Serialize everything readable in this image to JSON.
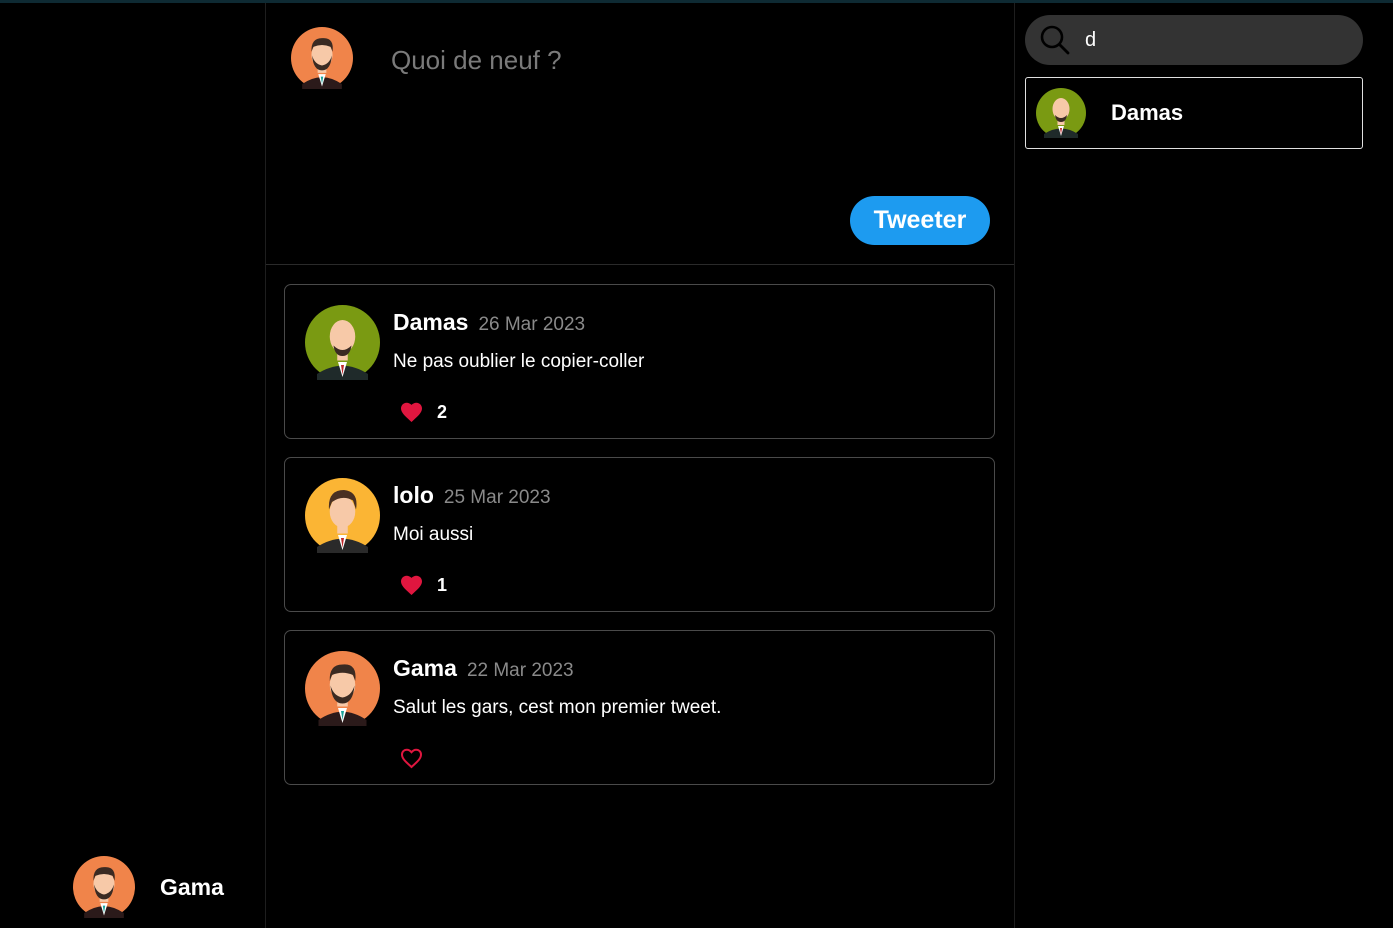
{
  "composer": {
    "placeholder": "Quoi de neuf ?",
    "tweet_label": "Tweeter"
  },
  "current_user": {
    "name": "Gama",
    "avatar": "avatar-orange-beard"
  },
  "search": {
    "value": "d",
    "icon": "search-icon"
  },
  "search_results": [
    {
      "name": "Damas",
      "avatar": "avatar-green-bald"
    }
  ],
  "tweets": [
    {
      "author": "Damas",
      "date": "26 Mar 2023",
      "text": "Ne pas oublier le copier-coller",
      "likes": "2",
      "liked": true,
      "avatar": "avatar-green-bald"
    },
    {
      "author": "lolo",
      "date": "25 Mar 2023",
      "text": "Moi aussi",
      "likes": "1",
      "liked": true,
      "avatar": "avatar-yellow-hair"
    },
    {
      "author": "Gama",
      "date": "22 Mar 2023",
      "text": "Salut les gars, cest mon premier tweet.",
      "likes": "",
      "liked": false,
      "avatar": "avatar-orange-beard"
    }
  ],
  "colors": {
    "accent": "#1d9bf0",
    "like": "#e0163f",
    "background": "#000000"
  }
}
